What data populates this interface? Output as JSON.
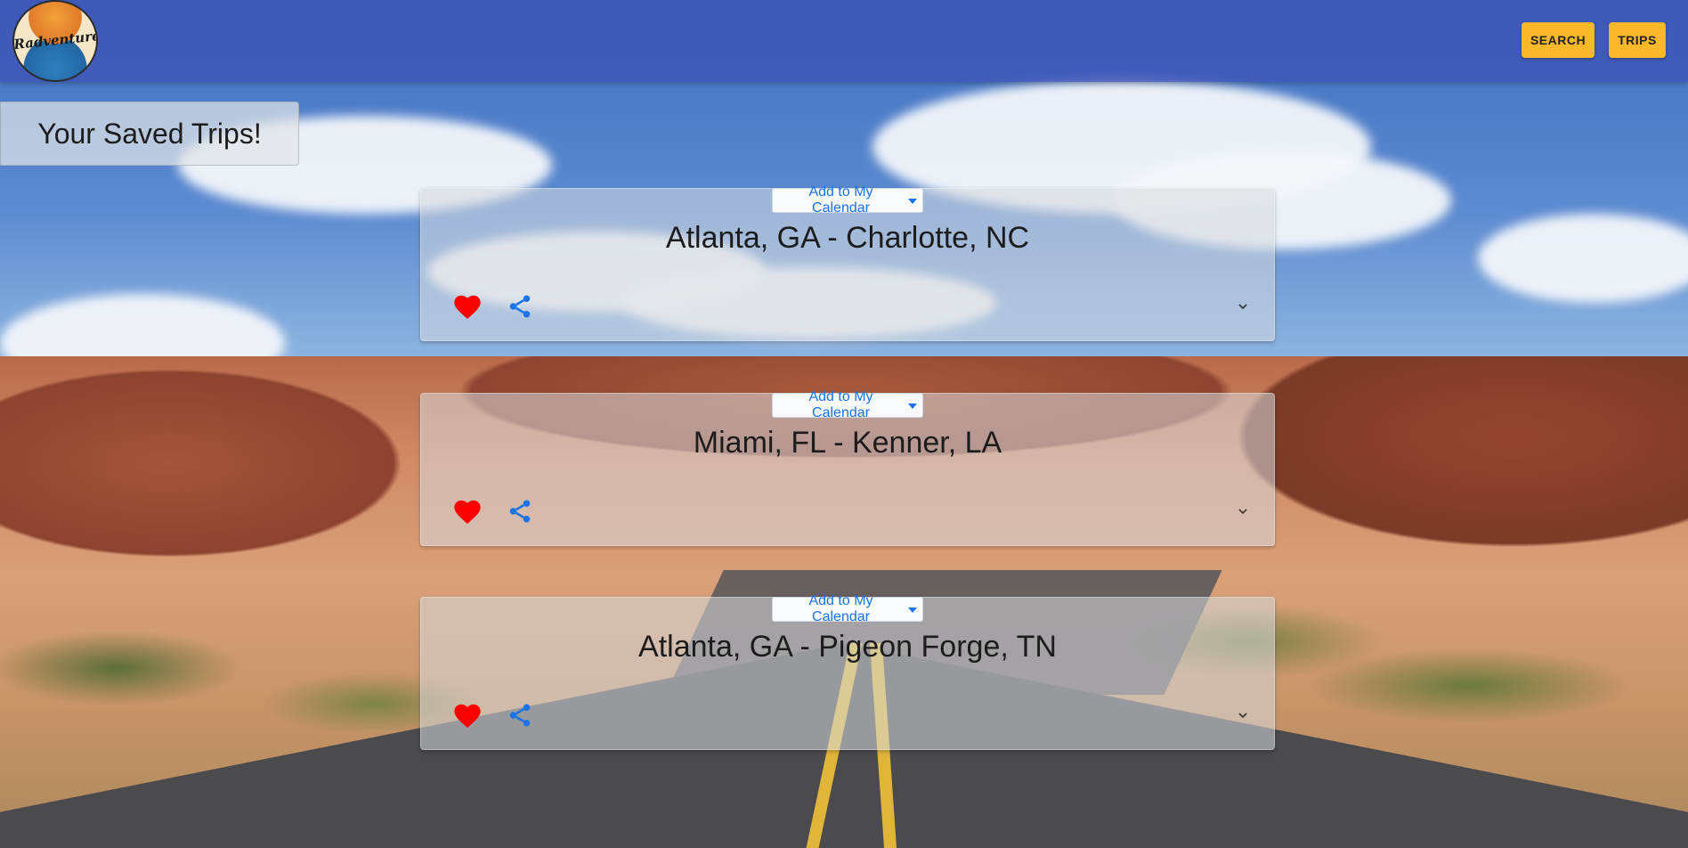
{
  "app": {
    "logo_text": "Radventure"
  },
  "nav": {
    "search_label": "SEARCH",
    "trips_label": "TRIPS"
  },
  "page": {
    "title": "Your Saved Trips!"
  },
  "trips": [
    {
      "route": "Atlanta, GA - Charlotte, NC",
      "calendar_label": "Add to My Calendar"
    },
    {
      "route": "Miami, FL - Kenner, LA",
      "calendar_label": "Add to My Calendar"
    },
    {
      "route": "Atlanta, GA - Pigeon Forge, TN",
      "calendar_label": "Add to My Calendar"
    }
  ],
  "icons": {
    "favorite": "heart-icon",
    "share": "share-icon",
    "expand": "chevron-down-icon"
  },
  "colors": {
    "header_bg": "#3f51b5",
    "nav_button": "#fbb829",
    "heart": "#ff0000",
    "share": "#1a73e8",
    "calendar_text": "#1a73e8"
  }
}
